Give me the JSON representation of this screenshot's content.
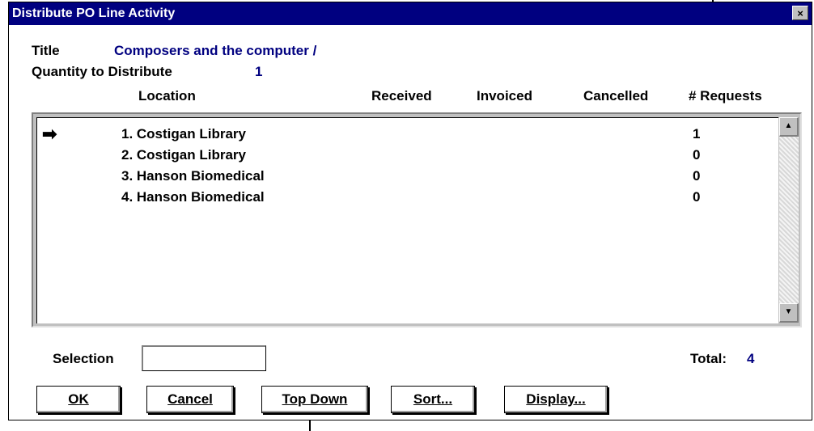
{
  "window": {
    "title": "Distribute PO Line Activity",
    "close_glyph": "×"
  },
  "header": {
    "title_label": "Title",
    "title_value": "Composers and the computer /",
    "qty_label": "Quantity to Distribute",
    "qty_value": "1"
  },
  "columns": [
    "Location",
    "Received",
    "Invoiced",
    "Cancelled",
    "# Requests"
  ],
  "rows": [
    {
      "location": "1. Costigan Library",
      "requests": "1"
    },
    {
      "location": "2. Costigan Library",
      "requests": "0"
    },
    {
      "location": "3. Hanson Biomedical",
      "requests": "0"
    },
    {
      "location": "4. Hanson Biomedical",
      "requests": "0"
    }
  ],
  "current_row_icon": "arrow-icon",
  "selection": {
    "label": "Selection",
    "value": ""
  },
  "total": {
    "label": "Total:",
    "value": "4"
  },
  "buttons": {
    "ok": "OK",
    "cancel": "Cancel",
    "top_down": "Top Down",
    "sort": "Sort...",
    "display": "Display..."
  },
  "colors": {
    "titlebar": "#000080",
    "value_text": "#000080"
  }
}
